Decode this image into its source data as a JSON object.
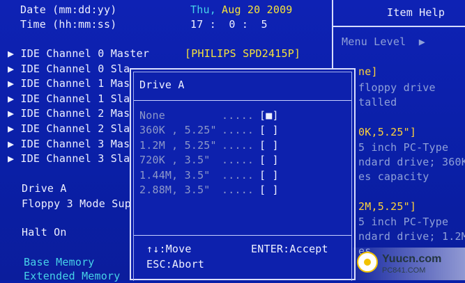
{
  "main": {
    "date_label": "Date (mm:dd:yy)",
    "time_label": "Time (hh:mm:ss)",
    "date_day": "Thu,",
    "date_value": "Aug 20 2009",
    "time_value": "17 :  0 :  5",
    "ide_items": [
      {
        "label": "IDE Channel 0 Master",
        "value": "[PHILIPS SPD2415P]"
      },
      {
        "label": "IDE Channel 0 Sla"
      },
      {
        "label": "IDE Channel 1 Mas"
      },
      {
        "label": "IDE Channel 1 Sla"
      },
      {
        "label": "IDE Channel 2 Mas"
      },
      {
        "label": "IDE Channel 2 Sla"
      },
      {
        "label": "IDE Channel 3 Mas"
      },
      {
        "label": "IDE Channel 3 Sla"
      }
    ],
    "drive_a_label": "Drive A",
    "floppy_mode_label": "Floppy 3 Mode Sup",
    "halt_on_label": "Halt On",
    "base_memory_label": "Base Memory",
    "extended_memory_label": "Extended Memory"
  },
  "help": {
    "title": "Item Help",
    "menu_level": "Menu Level",
    "lines": [
      "ne]",
      "floppy drive",
      "talled",
      "0K,5.25\"]",
      "5 inch PC-Type",
      "ndard drive; 360K",
      "es capacity",
      "2M,5.25\"]",
      "5 inch PC-Type",
      "ndard drive; 1.2M",
      "es"
    ]
  },
  "popup": {
    "title": "Drive A",
    "options": [
      {
        "label": "None",
        "dots": ".....",
        "mark": "[■]"
      },
      {
        "label": "360K , 5.25\"",
        "dots": ".....",
        "mark": "[ ]"
      },
      {
        "label": "1.2M , 5.25\"",
        "dots": ".....",
        "mark": "[ ]"
      },
      {
        "label": "720K , 3.5\"",
        "dots": ".....",
        "mark": "[ ]"
      },
      {
        "label": "1.44M, 3.5\"",
        "dots": ".....",
        "mark": "[ ]"
      },
      {
        "label": "2.88M, 3.5\"",
        "dots": ".....",
        "mark": "[ ]"
      }
    ],
    "move_hint": "↑↓:Move",
    "enter_hint": "ENTER:Accept",
    "abort_hint": "ESC:Abort"
  },
  "watermark": {
    "text": "Yuucn.com",
    "sub": "PC841.COM"
  },
  "colors": {
    "background": "#0a1fa8",
    "highlight_yellow": "#f5e23c",
    "cyan": "#46d2e8",
    "dim_gray": "#8d98c9"
  }
}
